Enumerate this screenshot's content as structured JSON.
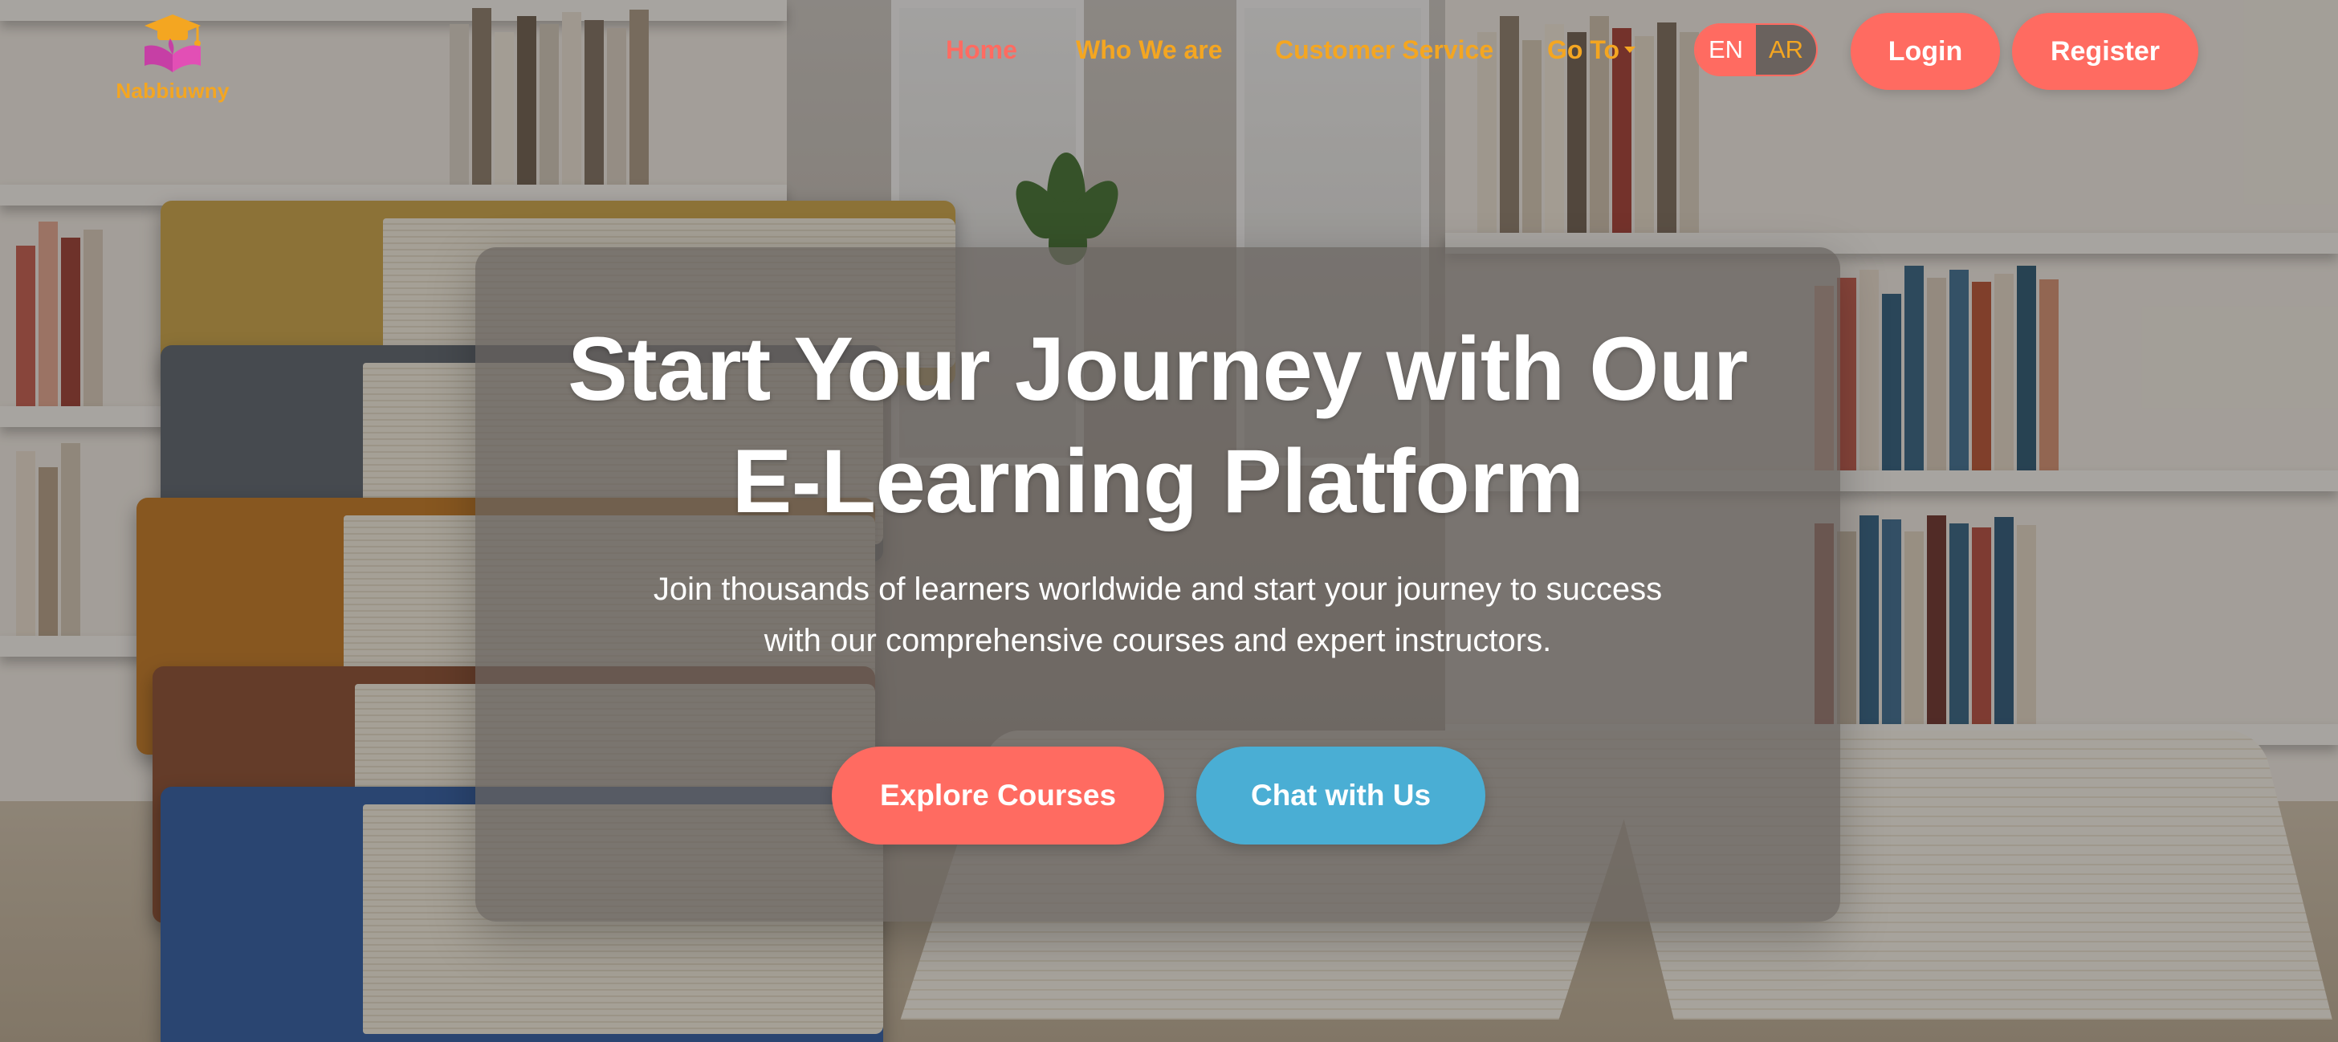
{
  "header": {
    "brand_name": "Nabbiuwny",
    "nav": {
      "home": "Home",
      "who_we_are": "Who We are",
      "customer_service": "Customer Service",
      "go_to": "Go To"
    },
    "language": {
      "en": "EN",
      "ar": "AR",
      "selected": "EN"
    },
    "login_label": "Login",
    "register_label": "Register"
  },
  "hero": {
    "title_line1": "Start Your Journey with Our",
    "title_line2": "E-Learning Platform",
    "subtitle_line1": "Join thousands of learners worldwide and start your journey to success",
    "subtitle_line2": "with our comprehensive courses and expert instructors.",
    "explore_label": "Explore Courses",
    "chat_label": "Chat with Us"
  },
  "colors": {
    "accent_coral": "#ff6b61",
    "nav_orange": "#f4a621",
    "chat_blue": "#4aaed4"
  },
  "icons": {
    "logo": "graduation-cap-book-logo-icon",
    "go_to_caret": "caret-down-icon"
  }
}
